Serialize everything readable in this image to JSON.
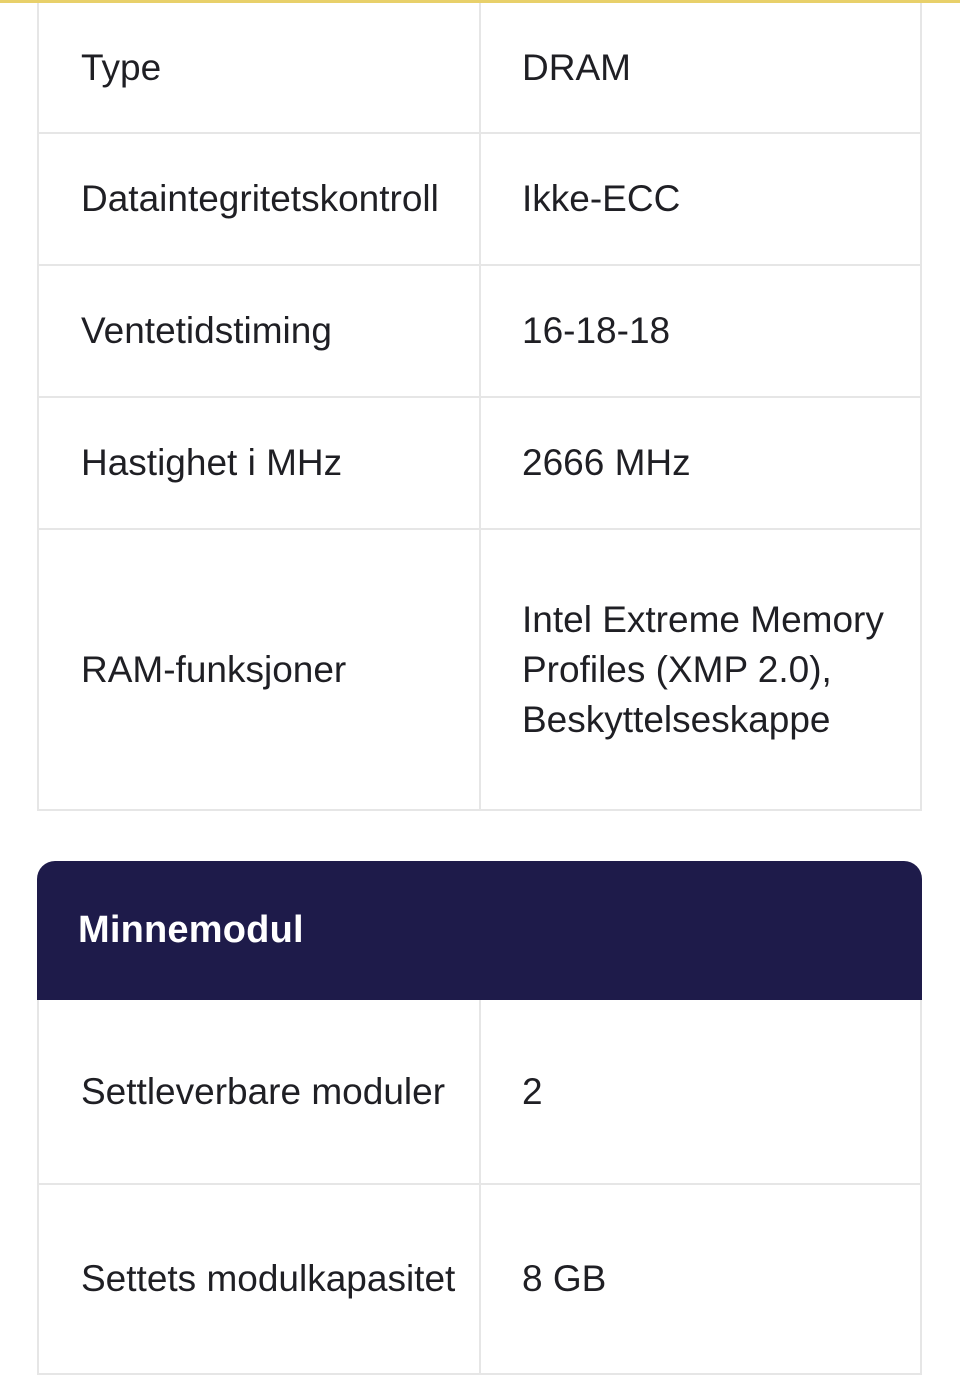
{
  "colors": {
    "header_bg": "#1e1b4a",
    "header_text": "#ffffff",
    "accent_line": "#e8d06a",
    "border": "#e6e6e6"
  },
  "specs": [
    {
      "label": "Type",
      "value": "DRAM"
    },
    {
      "label": "Dataintegritetskontroll",
      "value": "Ikke-ECC"
    },
    {
      "label": "Ventetidstiming",
      "value": "16-18-18"
    },
    {
      "label": "Hastighet i MHz",
      "value": "2666 MHz"
    },
    {
      "label": "RAM-funksjoner",
      "value": "Intel Extreme Memory Profiles (XMP 2.0), Beskyttelseskappe"
    }
  ],
  "section": {
    "title": "Minnemodul",
    "rows": [
      {
        "label": "Settleverbare moduler",
        "value": "2"
      },
      {
        "label": "Settets modulkapasitet",
        "value": "8 GB"
      }
    ]
  }
}
